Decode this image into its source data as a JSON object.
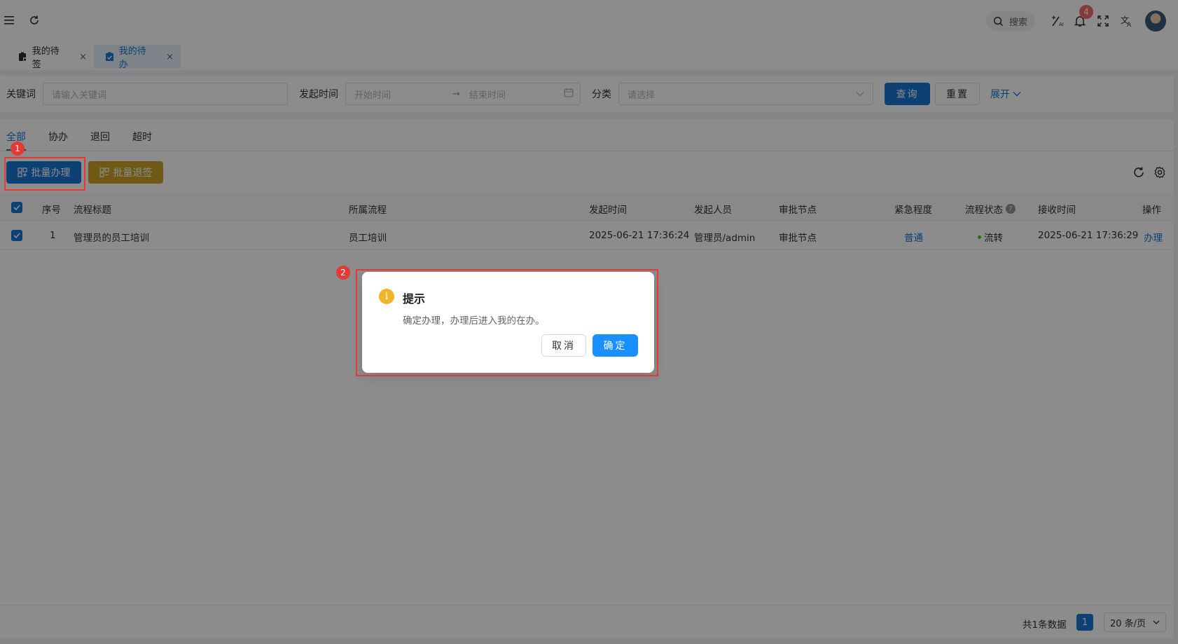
{
  "header": {
    "search_label": "搜索",
    "notification_count": "4"
  },
  "tabs": [
    {
      "label": "我的待签",
      "close": "×"
    },
    {
      "label": "我的待办",
      "close": "×"
    }
  ],
  "filter": {
    "keyword_label": "关键词",
    "keyword_placeholder": "请输入关键词",
    "time_label": "发起时间",
    "start_placeholder": "开始时间",
    "range_sep": "→",
    "end_placeholder": "结束时间",
    "category_label": "分类",
    "category_placeholder": "请选择",
    "query_button": "查询",
    "reset_button": "重置",
    "expand_link": "展开"
  },
  "filter_tabs": [
    "全部",
    "协办",
    "退回",
    "超时"
  ],
  "toolbar": {
    "batch_handle": "批量办理",
    "batch_return": "批量退签"
  },
  "table": {
    "columns": [
      "序号",
      "流程标题",
      "所属流程",
      "发起时间",
      "发起人员",
      "审批节点",
      "紧急程度",
      "流程状态",
      "接收时间",
      "操作"
    ],
    "rows": [
      {
        "index": "1",
        "title": "管理员的员工培训",
        "process": "员工培训",
        "start_time": "2025-06-21 17:36:24",
        "initiator": "管理员/admin",
        "node": "审批节点",
        "urgency": "普通",
        "status": "流转",
        "receive_time": "2025-06-21 17:36:29",
        "action": "办理"
      }
    ]
  },
  "pagination": {
    "total_text": "共1条数据",
    "current_page": "1",
    "page_size": "20 条/页"
  },
  "dialog": {
    "title": "提示",
    "message": "确定办理，办理后进入我的在办。",
    "cancel": "取消",
    "confirm": "确定"
  },
  "annotations": {
    "marker1": "1",
    "marker2": "2"
  },
  "colors": {
    "primary": "#1976d2",
    "warning": "#c9a227",
    "danger": "#e53935",
    "status_green": "#52c41a",
    "dialog_confirm": "#1890ff"
  }
}
